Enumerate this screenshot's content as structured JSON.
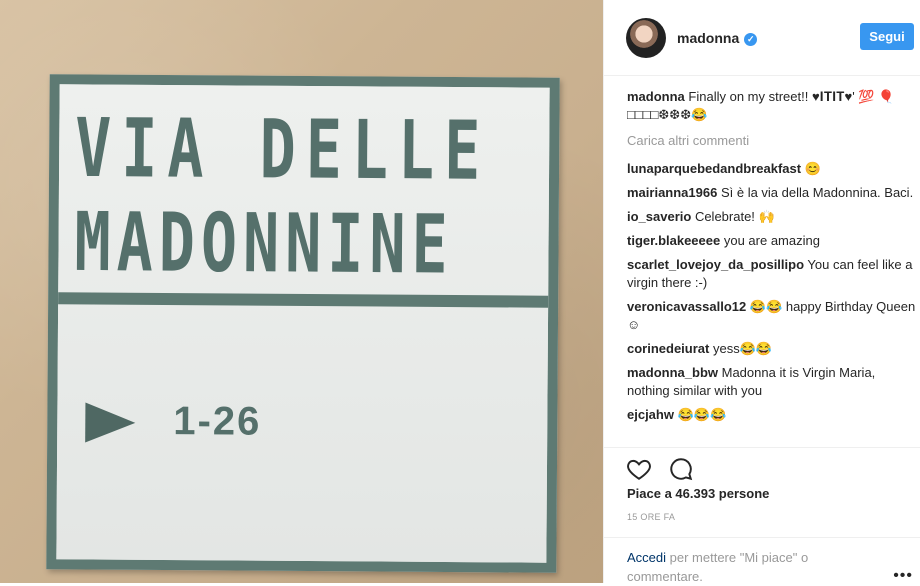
{
  "photo": {
    "sign_line1": "VIA DELLE",
    "sign_line2": "MADONNINE",
    "house_numbers": "1-26"
  },
  "post": {
    "username": "madonna",
    "verified_icon": "verified-badge-icon",
    "follow_label": "Segui",
    "caption": {
      "user": "madonna",
      "text": "Finally on my street!! ♥𝐈𝐓𝐈𝐓♥' 💯 🎈□□□□❆❆❆😂"
    },
    "load_more": "Carica altri commenti",
    "comments": [
      {
        "user": "lunaparquebedandbreakfast",
        "text": " 😊"
      },
      {
        "user": "mairianna1966",
        "text": " Sì è la via della Madonnina. Baci."
      },
      {
        "user": "io_saverio",
        "text": " Celebrate! 🙌"
      },
      {
        "user": "tiger.blakeeeee",
        "text": " you are amazing"
      },
      {
        "user": "scarlet_lovejoy_da_posillipo",
        "text": " You can feel like a virgin there :-)"
      },
      {
        "user": "veronicavassallo12",
        "text": " 😂😂 happy Birthday Queen ☺"
      },
      {
        "user": "corinedeiurat",
        "text": " yess😂😂"
      },
      {
        "user": "madonna_bbw",
        "text": " Madonna it is Virgin Maria, nothing similar with you"
      },
      {
        "user": "ejcjahw",
        "text": " 😂😂😂"
      }
    ],
    "likes": "Piace a 46.393 persone",
    "timestamp": "15 ORE FA",
    "login_link": "Accedi",
    "login_text": " per mettere \"Mi piace\" o commentare.",
    "more_icon": "more-options-icon"
  },
  "colors": {
    "accent": "#3897f0",
    "sign_green": "#5e7a73"
  }
}
